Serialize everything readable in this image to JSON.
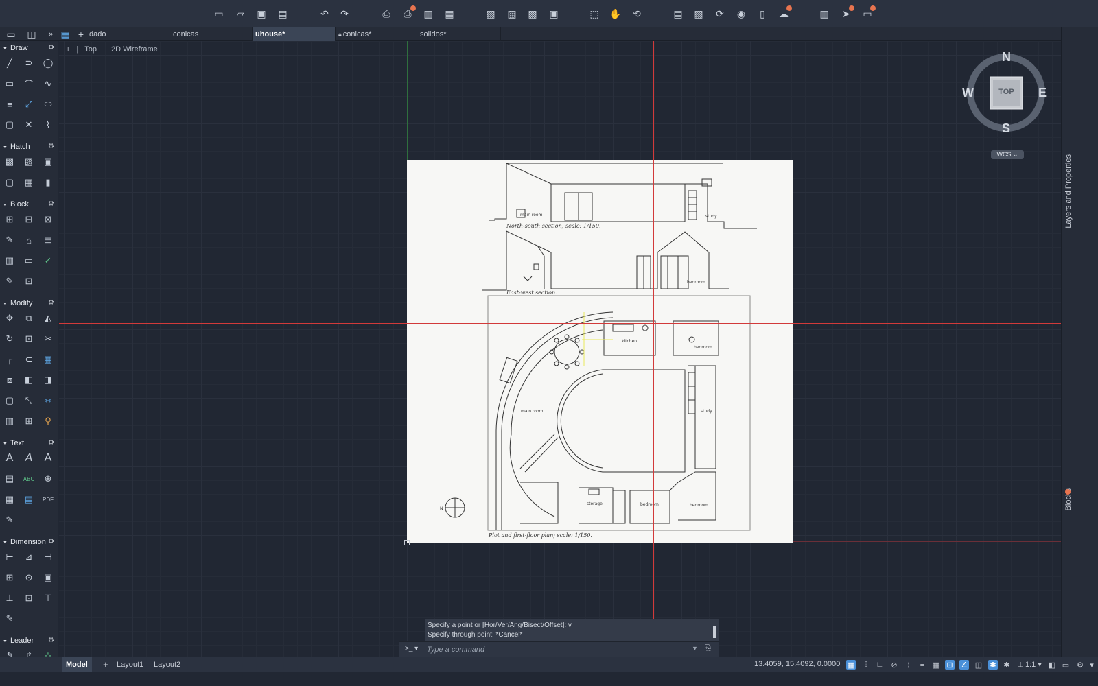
{
  "toolbar": {
    "icons": [
      "new-icon",
      "open-icon",
      "save-icon",
      "save-as-icon",
      "undo-icon",
      "redo-icon",
      "plot-icon",
      "batch-plot-icon",
      "sheet-set-icon",
      "publish-icon",
      "import-icon",
      "export-icon",
      "attach-icon",
      "xref-icon",
      "selection-icon",
      "pan-icon",
      "orbit-icon",
      "properties-icon",
      "match-icon",
      "sync-icon",
      "layer-icon",
      "file-icon",
      "cloud-icon",
      "workspace-icon",
      "share-icon",
      "account-icon"
    ]
  },
  "tabs": {
    "items": [
      {
        "label": "dado",
        "active": false,
        "locked": false
      },
      {
        "label": "conicas",
        "active": false,
        "locked": false
      },
      {
        "label": "uhouse*",
        "active": true,
        "locked": false
      },
      {
        "label": "conicas*",
        "active": false,
        "locked": true
      },
      {
        "label": "solidos*",
        "active": false,
        "locked": false
      }
    ]
  },
  "palette": {
    "sections": [
      {
        "title": "Draw"
      },
      {
        "title": "Hatch"
      },
      {
        "title": "Block"
      },
      {
        "title": "Modify"
      },
      {
        "title": "Text"
      },
      {
        "title": "Dimension"
      },
      {
        "title": "Leader"
      }
    ]
  },
  "viewport": {
    "plus": "+",
    "view": "Top",
    "style": "2D Wireframe"
  },
  "compass": {
    "north": "N",
    "south": "S",
    "east": "E",
    "west": "W",
    "cube_face": "TOP",
    "ucs": "WCS"
  },
  "drawing": {
    "ns_caption": "North-south section; scale: 1/150.",
    "ew_caption": "East-west section.",
    "plan_caption": "Plot and first-floor plan; scale: 1/150.",
    "rooms": {
      "main_room": "main room",
      "study": "study",
      "bedroom": "bedroom",
      "kitchen": "kitchen",
      "storage": "storage",
      "north": "N"
    }
  },
  "right_panel": {
    "layers_label": "Layers and Properties",
    "blocks_label": "Blocks"
  },
  "command": {
    "history": [
      "Specify a point or [Hor/Ver/Ang/Bisect/Offset]: v",
      "Specify through point: *Cancel*"
    ],
    "prompt": ">_",
    "placeholder": "Type a command"
  },
  "status": {
    "layouts": [
      "Model",
      "Layout1",
      "Layout2"
    ],
    "coords": "13.4059, 15.4092, 0.0000",
    "scale": "1:1",
    "accent": "#4a90d9"
  }
}
